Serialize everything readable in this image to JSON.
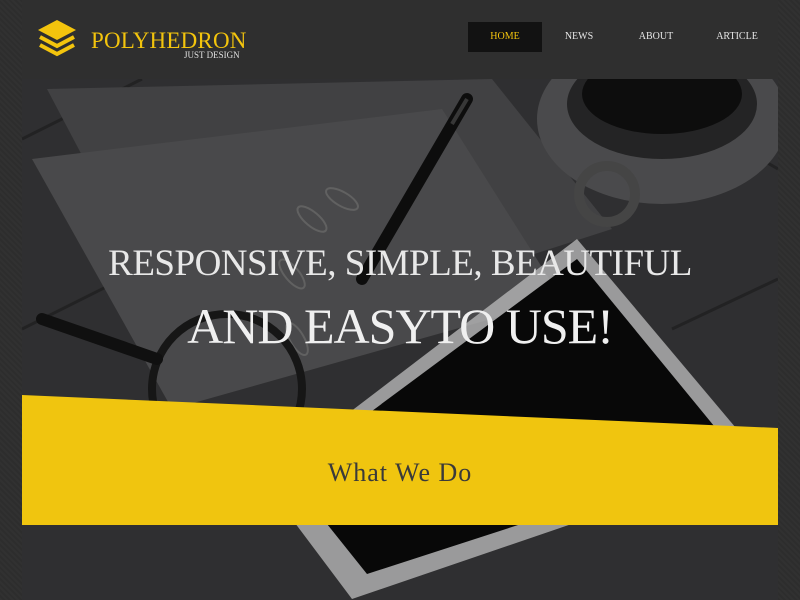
{
  "brand": {
    "name": "POLYHEDRON",
    "tagline": "JUST DESIGN",
    "accent": "#f3c40d"
  },
  "nav": {
    "items": [
      {
        "label": "HOME",
        "active": true
      },
      {
        "label": "NEWS",
        "active": false
      },
      {
        "label": "ABOUT",
        "active": false
      },
      {
        "label": "ARTICLE",
        "active": false
      }
    ]
  },
  "hero": {
    "line1": "RESPONSIVE, SIMPLE, BEAUTIFUL",
    "line2": "AND EASYTO USE!"
  },
  "section": {
    "title": "What We Do",
    "band_color": "#f0c50f"
  }
}
